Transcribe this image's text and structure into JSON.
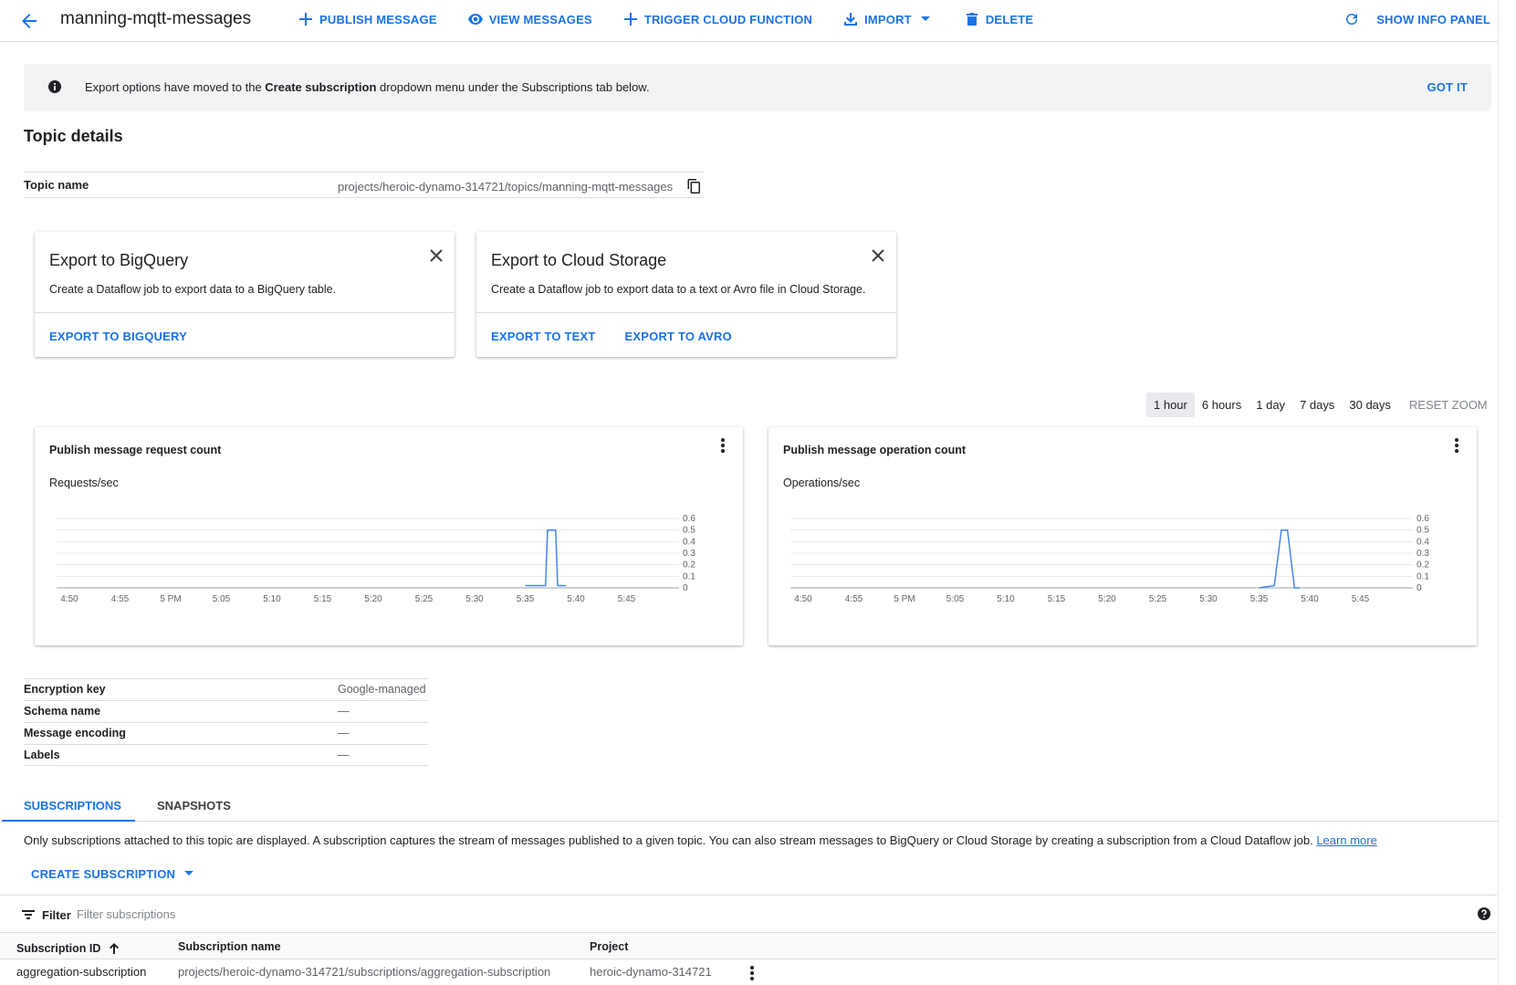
{
  "topbar": {
    "title": "manning-mqtt-messages",
    "actions": [
      {
        "label": "PUBLISH MESSAGE",
        "icon": "plus-icon"
      },
      {
        "label": "VIEW MESSAGES",
        "icon": "eye-icon"
      },
      {
        "label": "TRIGGER CLOUD FUNCTION",
        "icon": "plus-icon"
      },
      {
        "label": "IMPORT",
        "icon": "import-icon"
      },
      {
        "label": "DELETE",
        "icon": "trash-icon"
      }
    ],
    "show_info_panel": "SHOW INFO PANEL"
  },
  "banner": {
    "text_before": "Export options have moved to the ",
    "text_bold": "Create subscription",
    "text_after": " dropdown menu under the Subscriptions tab below.",
    "dismiss": "GOT IT"
  },
  "topic_details": {
    "heading": "Topic details",
    "name_label": "Topic name",
    "name_value": "projects/heroic-dynamo-314721/topics/manning-mqtt-messages"
  },
  "export_cards": [
    {
      "title": "Export to BigQuery",
      "description": "Create a Dataflow job to export data to a BigQuery table.",
      "actions": [
        "EXPORT TO BIGQUERY"
      ]
    },
    {
      "title": "Export to Cloud Storage",
      "description": "Create a Dataflow job to export data to a text or Avro file in Cloud Storage.",
      "actions": [
        "EXPORT TO TEXT",
        "EXPORT TO AVRO"
      ]
    }
  ],
  "time_range": {
    "options": [
      "1 hour",
      "6 hours",
      "1 day",
      "7 days",
      "30 days"
    ],
    "selected": "1 hour",
    "reset": "RESET ZOOM"
  },
  "chart_data": [
    {
      "type": "line",
      "title": "Publish message request count",
      "ylabel": "Requests/sec",
      "x": [
        "4:50",
        "4:55",
        "5 PM",
        "5:05",
        "5:10",
        "5:15",
        "5:20",
        "5:25",
        "5:30",
        "5:35",
        "5:40",
        "5:45"
      ],
      "yticks": [
        "0.6",
        "0.5",
        "0.4",
        "0.3",
        "0.2",
        "0.1",
        "0"
      ],
      "ylim": [
        0,
        0.6
      ],
      "series": [
        {
          "color": "#4285f4",
          "points": [
            [
              5.35,
              0.02
            ],
            [
              5.37,
              0.02
            ],
            [
              5.372,
              0.5
            ],
            [
              5.38,
              0.5
            ],
            [
              5.382,
              0.02
            ],
            [
              5.39,
              0.02
            ]
          ]
        }
      ]
    },
    {
      "type": "line",
      "title": "Publish message operation count",
      "ylabel": "Operations/sec",
      "x": [
        "4:50",
        "4:55",
        "5 PM",
        "5:05",
        "5:10",
        "5:15",
        "5:20",
        "5:25",
        "5:30",
        "5:35",
        "5:40",
        "5:45"
      ],
      "yticks": [
        "0.6",
        "0.5",
        "0.4",
        "0.3",
        "0.2",
        "0.1",
        "0"
      ],
      "ylim": [
        0,
        0.6
      ],
      "series": [
        {
          "color": "#4285f4",
          "points": [
            [
              5.35,
              0.0
            ],
            [
              5.365,
              0.02
            ],
            [
              5.372,
              0.5
            ],
            [
              5.378,
              0.5
            ],
            [
              5.385,
              0.0
            ],
            [
              5.39,
              0.0
            ]
          ]
        }
      ]
    }
  ],
  "properties": [
    {
      "label": "Encryption key",
      "value": "Google-managed"
    },
    {
      "label": "Schema name",
      "value": "—"
    },
    {
      "label": "Message encoding",
      "value": "—"
    },
    {
      "label": "Labels",
      "value": "—"
    }
  ],
  "tabs": [
    {
      "label": "SUBSCRIPTIONS",
      "active": true
    },
    {
      "label": "SNAPSHOTS",
      "active": false
    }
  ],
  "subscriptions": {
    "description": "Only subscriptions attached to this topic are displayed. A subscription captures the stream of messages published to a given topic. You can also stream messages to BigQuery or Cloud Storage by creating a subscription from a Cloud Dataflow job. ",
    "learn_more": "Learn more",
    "create_button": "CREATE SUBSCRIPTION",
    "filter_label": "Filter",
    "filter_placeholder": "Filter subscriptions",
    "columns": [
      "Subscription ID",
      "Subscription name",
      "Project"
    ],
    "rows": [
      [
        "aggregation-subscription",
        "projects/heroic-dynamo-314721/subscriptions/aggregation-subscription",
        "heroic-dynamo-314721"
      ]
    ]
  },
  "colors": {
    "accent": "#1a73e8",
    "series": "#4285f4"
  }
}
